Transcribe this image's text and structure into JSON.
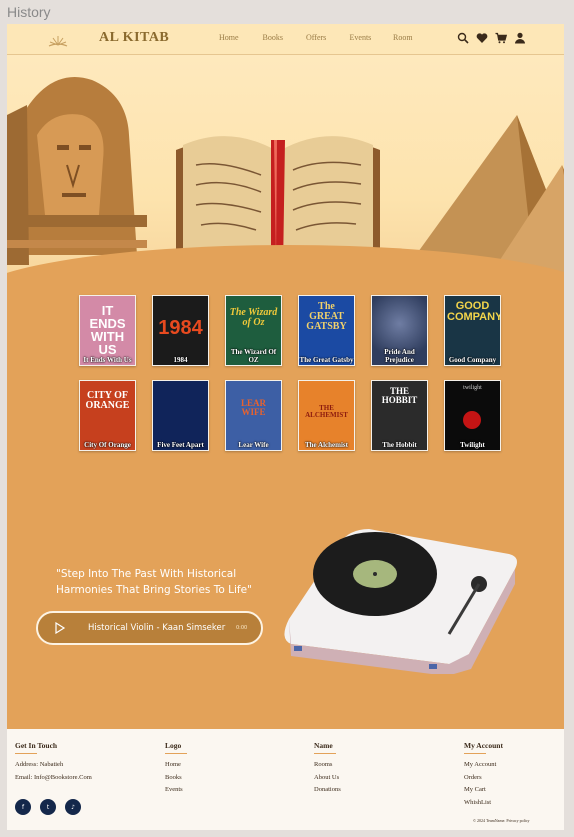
{
  "frame": {
    "title": "History"
  },
  "header": {
    "brand": "AL KITAB",
    "nav": [
      "Home",
      "Books",
      "Offers",
      "Events",
      "Room"
    ],
    "icons": [
      "search-icon",
      "heart-icon",
      "cart-icon",
      "user-icon"
    ]
  },
  "books": [
    {
      "title": "It Ends With Us",
      "art": "IT ENDS WITH US",
      "bg": "#d38aa7",
      "fg": "#fff"
    },
    {
      "title": "1984",
      "art": "1984",
      "bg": "#1b1b1b",
      "fg": "#e84a1f"
    },
    {
      "title": "The Wizard Of OZ",
      "art": "The Wizard of Oz",
      "bg": "#1e5d3e",
      "fg": "#f0c93a"
    },
    {
      "title": "The Great Gatsby",
      "art": "The GREAT GATSBY",
      "bg": "#1b4aa3",
      "fg": "#f2d26b"
    },
    {
      "title": "Pride And Prejudice",
      "art": "",
      "bg": "#2f3d5e",
      "fg": "#d9c28a"
    },
    {
      "title": "Good Company",
      "art": "GOOD COMPANY",
      "bg": "#193545",
      "fg": "#f3d54b"
    },
    {
      "title": "City Of Orange",
      "art": "CITY OF ORANGE",
      "bg": "#c6401e",
      "fg": "#fff"
    },
    {
      "title": "Five Feet Apart",
      "art": "",
      "bg": "#10245a",
      "fg": "#ffffff"
    },
    {
      "title": "Lear Wife",
      "art": "LEAR WIFE",
      "bg": "#3d5fa5",
      "fg": "#e8622d"
    },
    {
      "title": "The Alchemist",
      "art": "THE ALCHEMIST",
      "bg": "#e7822b",
      "fg": "#8c1b0e"
    },
    {
      "title": "The Hobbit",
      "art": "THE HOBBIT",
      "bg": "#2b2b2b",
      "fg": "#ffffff"
    },
    {
      "title": "Twilight",
      "art": "twilight",
      "bg": "#0b0b0b",
      "fg": "#cccccc"
    }
  ],
  "music": {
    "quote": "\"Step Into The Past With Historical Harmonies That Bring Stories To Life\"",
    "track": "Historical Violin - Kaan Simseker",
    "time": "0:00"
  },
  "footer": {
    "col1": {
      "title": "Get In Touch",
      "address": "Address: Nabatieh",
      "email": "Email: Info@Bookstore.Com"
    },
    "col2": {
      "title": "Logo",
      "links": [
        "Home",
        "Books",
        "Events"
      ]
    },
    "col3": {
      "title": "Name",
      "links": [
        "Rooms",
        "About Us",
        "Donations"
      ]
    },
    "col4": {
      "title": "My Account",
      "links": [
        "My Account",
        "Orders",
        "My Cart",
        "WhishList"
      ]
    },
    "socials": [
      "f",
      "t",
      "♪"
    ],
    "copyright": "© 2024 TeamName. Privacy policy"
  },
  "colors": {
    "accent": "#e3a259",
    "header": "#fde7b7",
    "footer": "#fbf7f1",
    "social": "#14284b"
  }
}
